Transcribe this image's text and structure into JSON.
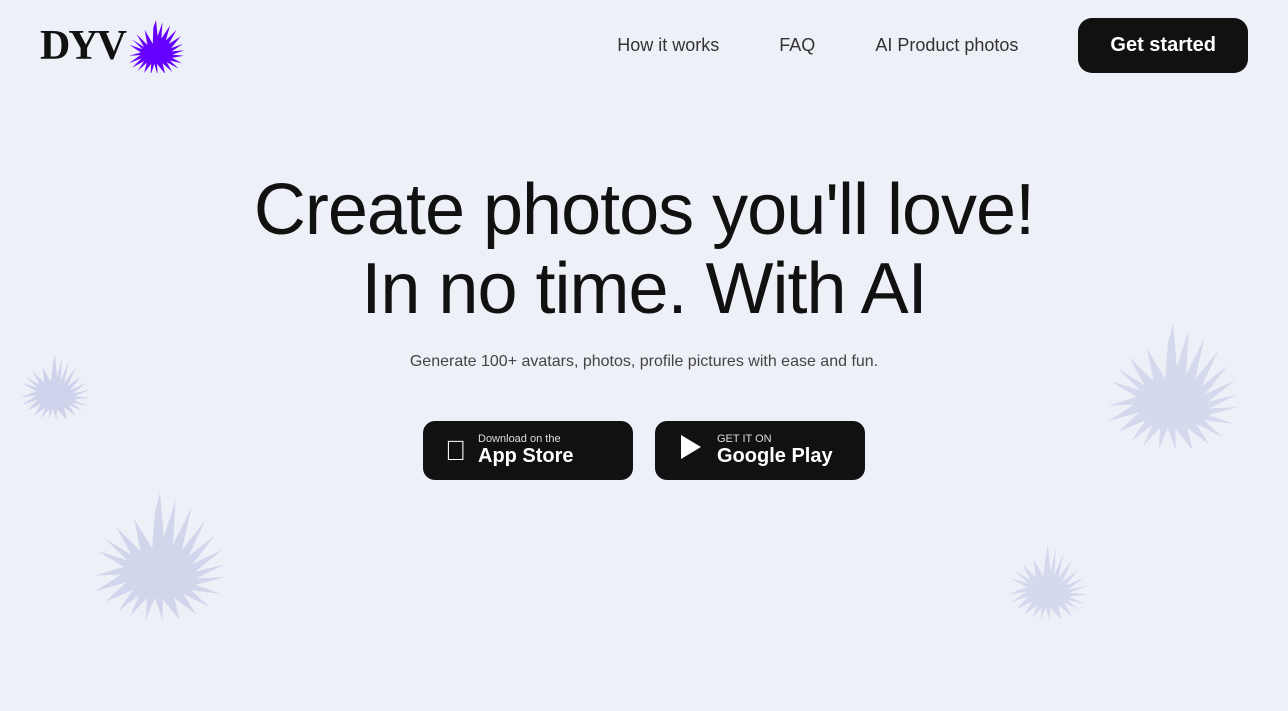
{
  "logo": {
    "text": "DYV",
    "alt": "DYVO logo"
  },
  "nav": {
    "links": [
      {
        "label": "How it works",
        "id": "how-it-works"
      },
      {
        "label": "FAQ",
        "id": "faq"
      },
      {
        "label": "AI Product photos",
        "id": "ai-product-photos"
      }
    ],
    "cta_label": "Get started"
  },
  "hero": {
    "title_line1": "Create photos you'll love!",
    "title_line2": "In no time. With AI",
    "subtitle": "Generate 100+ avatars, photos, profile pictures with ease and fun."
  },
  "app_store": {
    "label_small": "Download on the",
    "label_large": "App Store"
  },
  "google_play": {
    "label_small": "GET IT ON",
    "label_large": "Google Play"
  },
  "colors": {
    "burst_logo": "#6600ff",
    "burst_deco": "#b0b8e0",
    "background": "#eef0f7",
    "dark": "#111111"
  }
}
